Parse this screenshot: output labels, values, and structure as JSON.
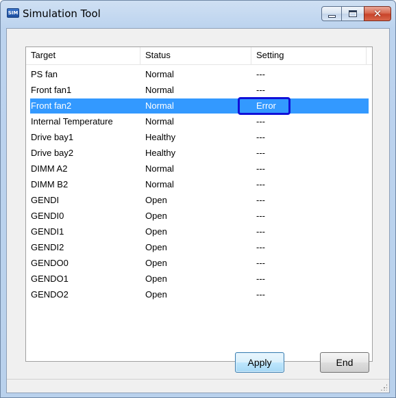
{
  "window": {
    "title": "Simulation Tool",
    "icon_text": "SIM"
  },
  "caption_buttons": {
    "minimize": "minimize-icon",
    "maximize": "maximize-icon",
    "close": "close-icon"
  },
  "table": {
    "columns": [
      "Target",
      "Status",
      "Setting"
    ],
    "rows": [
      {
        "target": "PS fan",
        "status": "Normal",
        "setting": "---"
      },
      {
        "target": "Front fan1",
        "status": "Normal",
        "setting": "---"
      },
      {
        "target": "Front fan2",
        "status": "Normal",
        "setting": "Error"
      },
      {
        "target": "Internal Temperature",
        "status": "Normal",
        "setting": "---"
      },
      {
        "target": "Drive bay1",
        "status": "Healthy",
        "setting": "---"
      },
      {
        "target": "Drive bay2",
        "status": "Healthy",
        "setting": "---"
      },
      {
        "target": "DIMM A2",
        "status": "Normal",
        "setting": "---"
      },
      {
        "target": "DIMM B2",
        "status": "Normal",
        "setting": "---"
      },
      {
        "target": "GENDI",
        "status": "Open",
        "setting": "---"
      },
      {
        "target": "GENDI0",
        "status": "Open",
        "setting": "---"
      },
      {
        "target": "GENDI1",
        "status": "Open",
        "setting": "---"
      },
      {
        "target": "GENDI2",
        "status": "Open",
        "setting": "---"
      },
      {
        "target": "GENDO0",
        "status": "Open",
        "setting": "---"
      },
      {
        "target": "GENDO1",
        "status": "Open",
        "setting": "---"
      },
      {
        "target": "GENDO2",
        "status": "Open",
        "setting": "---"
      }
    ],
    "selected_index": 2,
    "highlight_color": "#3399ff",
    "callout_color": "#1010d8"
  },
  "buttons": {
    "apply": "Apply",
    "end": "End"
  }
}
